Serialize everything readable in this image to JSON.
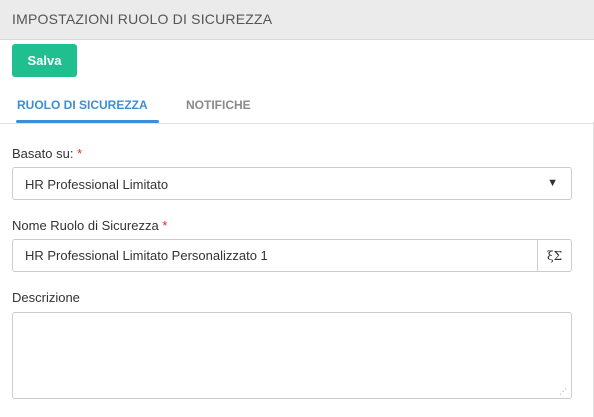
{
  "header": {
    "title": "IMPOSTAZIONI RUOLO DI SICUREZZA"
  },
  "toolbar": {
    "save_label": "Salva"
  },
  "tabs": [
    {
      "label": "RUOLO DI SICUREZZA",
      "active": true
    },
    {
      "label": "NOTIFICHE",
      "active": false
    }
  ],
  "form": {
    "based_on": {
      "label": "Basato su:",
      "required_mark": "*",
      "value": "HR Professional Limitato",
      "arrow": "▼"
    },
    "role_name": {
      "label": "Nome Ruolo di Sicurezza",
      "required_mark": "*",
      "value": "HR Professional Limitato Personalizzato 1",
      "addon_icon": "translate-icon",
      "addon_glyph": "ξΣ"
    },
    "description": {
      "label": "Descrizione",
      "value": ""
    }
  },
  "colors": {
    "accent": "#3d8ed4",
    "save_button": "#1fbf8f",
    "required": "#d9312b",
    "header_bg": "#ebebeb"
  }
}
